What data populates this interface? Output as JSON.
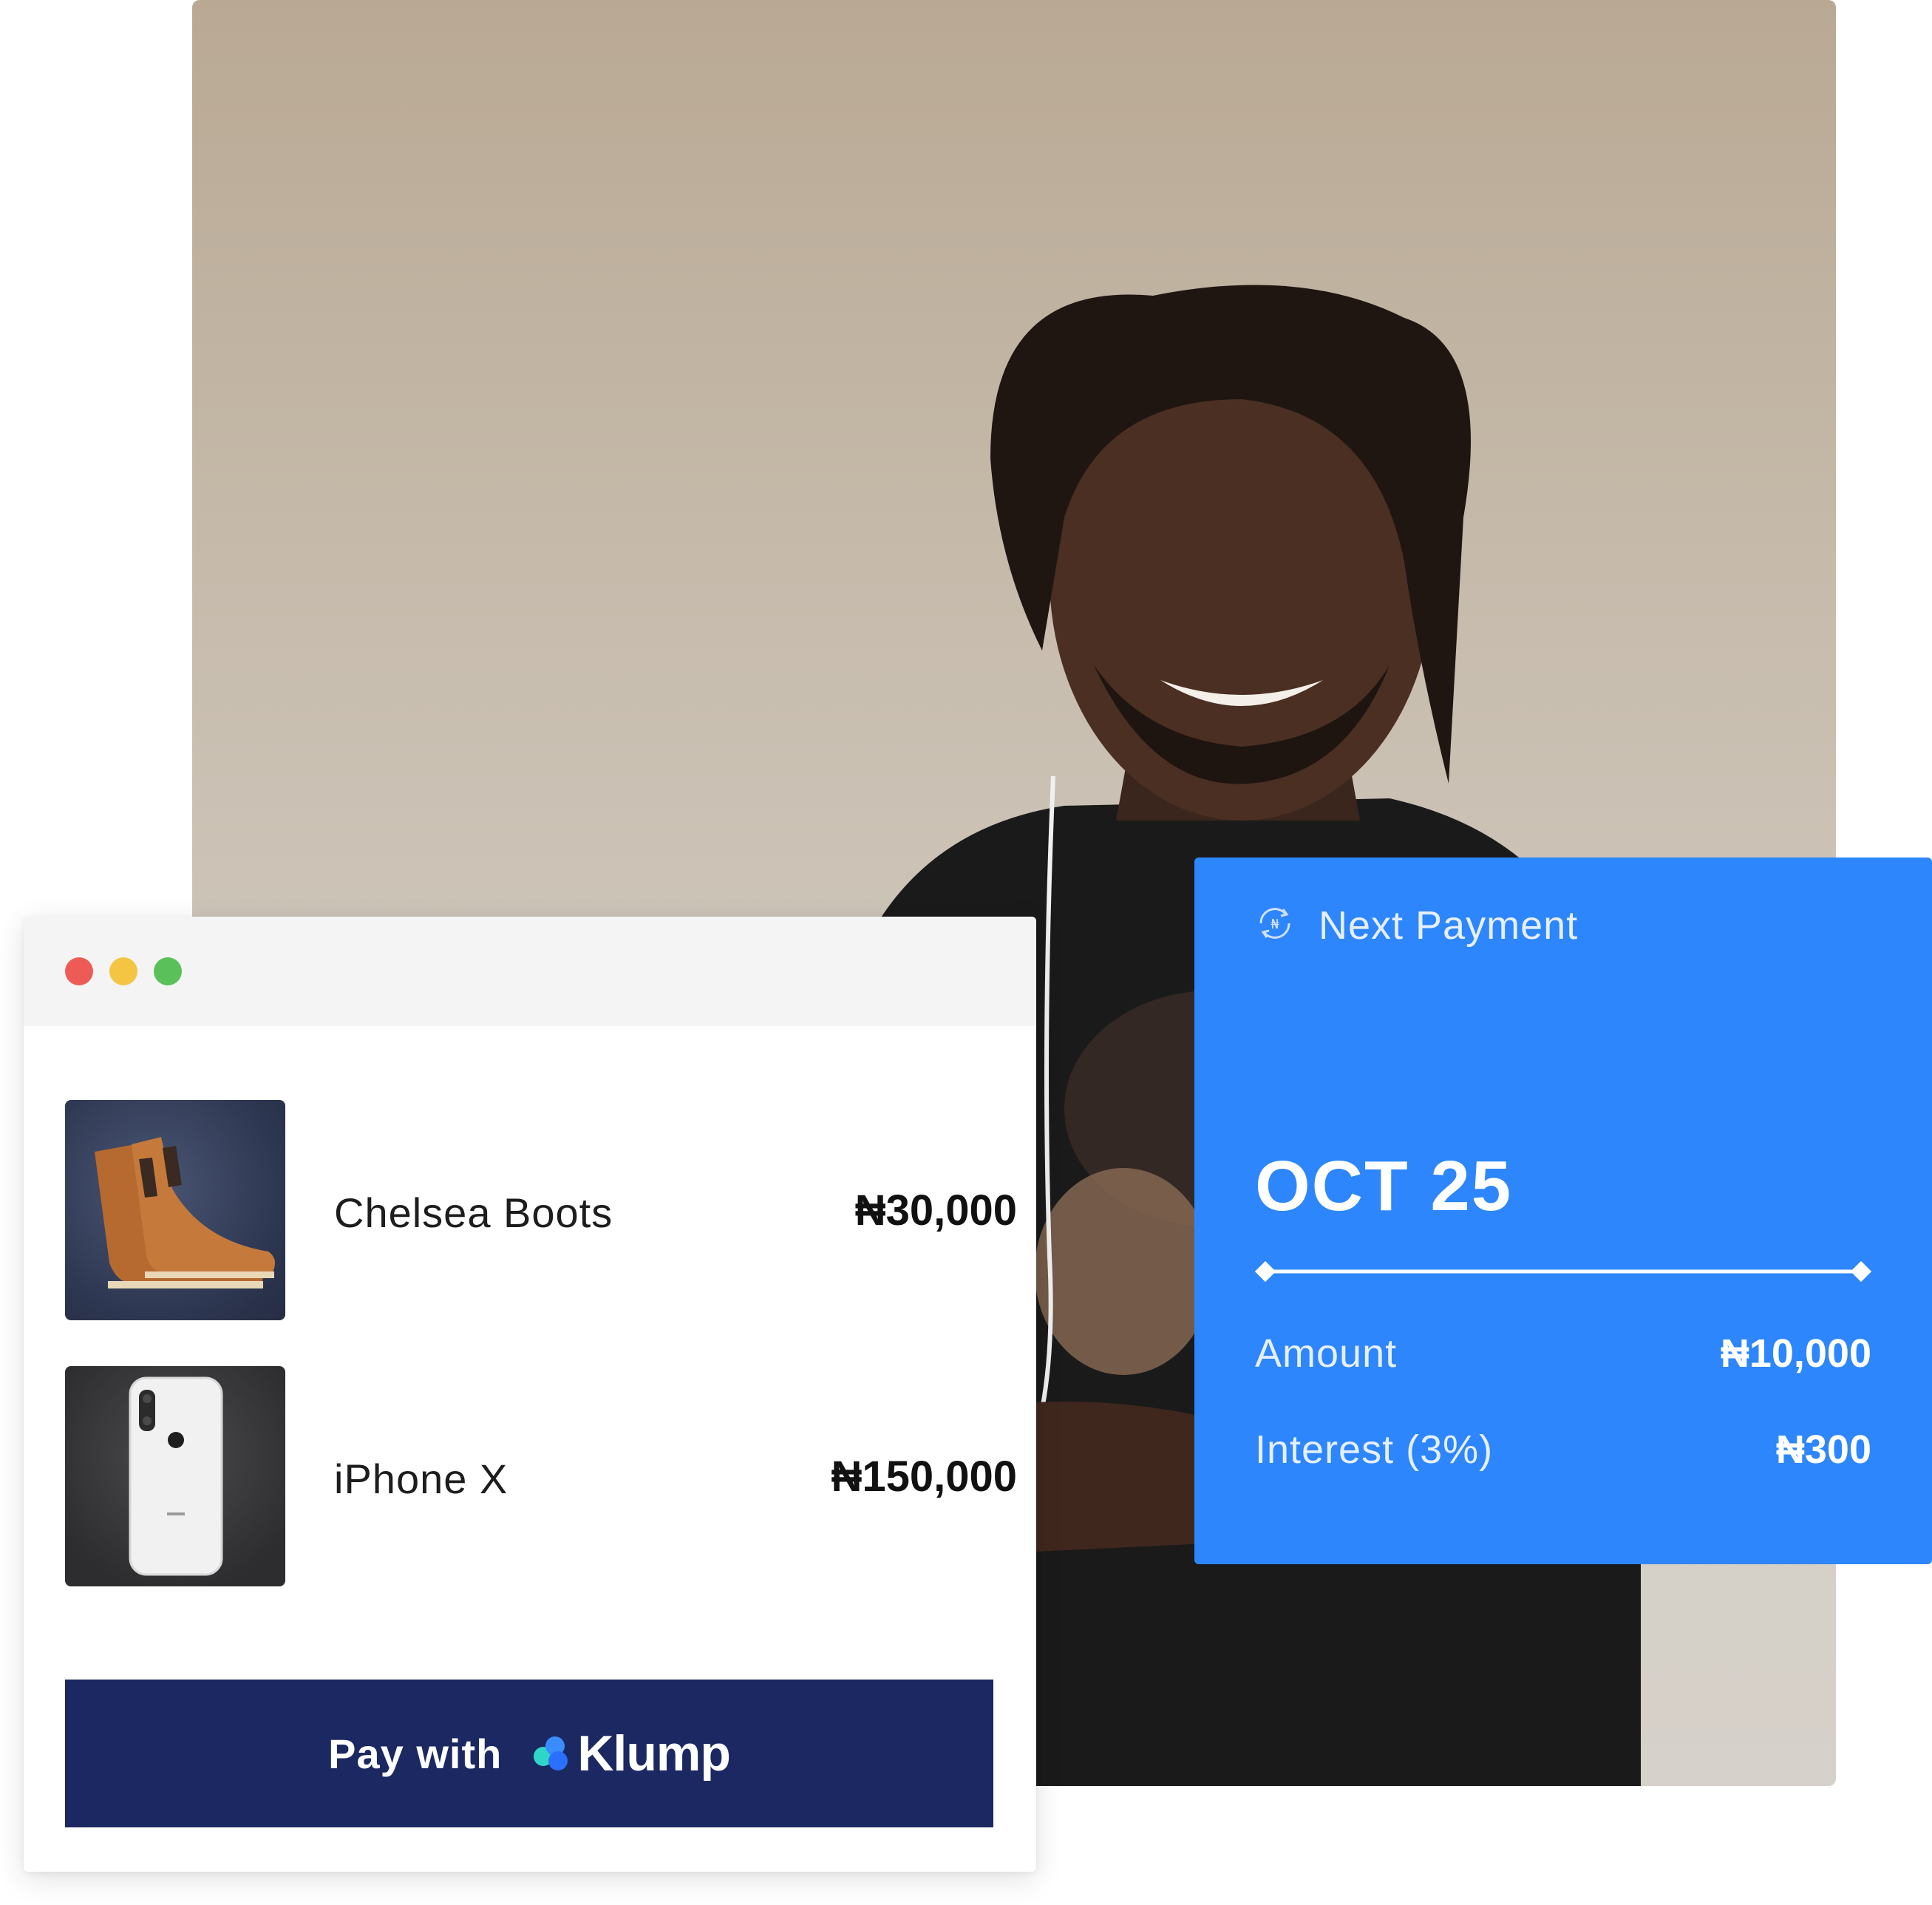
{
  "checkout": {
    "items": [
      {
        "name": "Chelsea Boots",
        "price": "₦30,000",
        "image": "chelsea-boots-photo"
      },
      {
        "name": "iPhone X",
        "price": "₦150,000",
        "image": "iphone-x-photo"
      }
    ],
    "pay_button": {
      "label": "Pay with",
      "brand": "Klump"
    }
  },
  "next_payment": {
    "title": "Next Payment",
    "date": "OCT 25",
    "amount_label": "Amount",
    "amount_value": "₦10,000",
    "interest_label": "Interest (3%)",
    "interest_value": "₦300"
  },
  "colors": {
    "card_blue": "#2d86fb",
    "button_navy": "#1c2861",
    "traffic_red": "#ee5b56",
    "traffic_yellow": "#f4c543",
    "traffic_green": "#5ac05a"
  },
  "icons": {
    "payment_cycle": "naira-cycle-icon",
    "brand_logo": "klump-logo-icon"
  }
}
